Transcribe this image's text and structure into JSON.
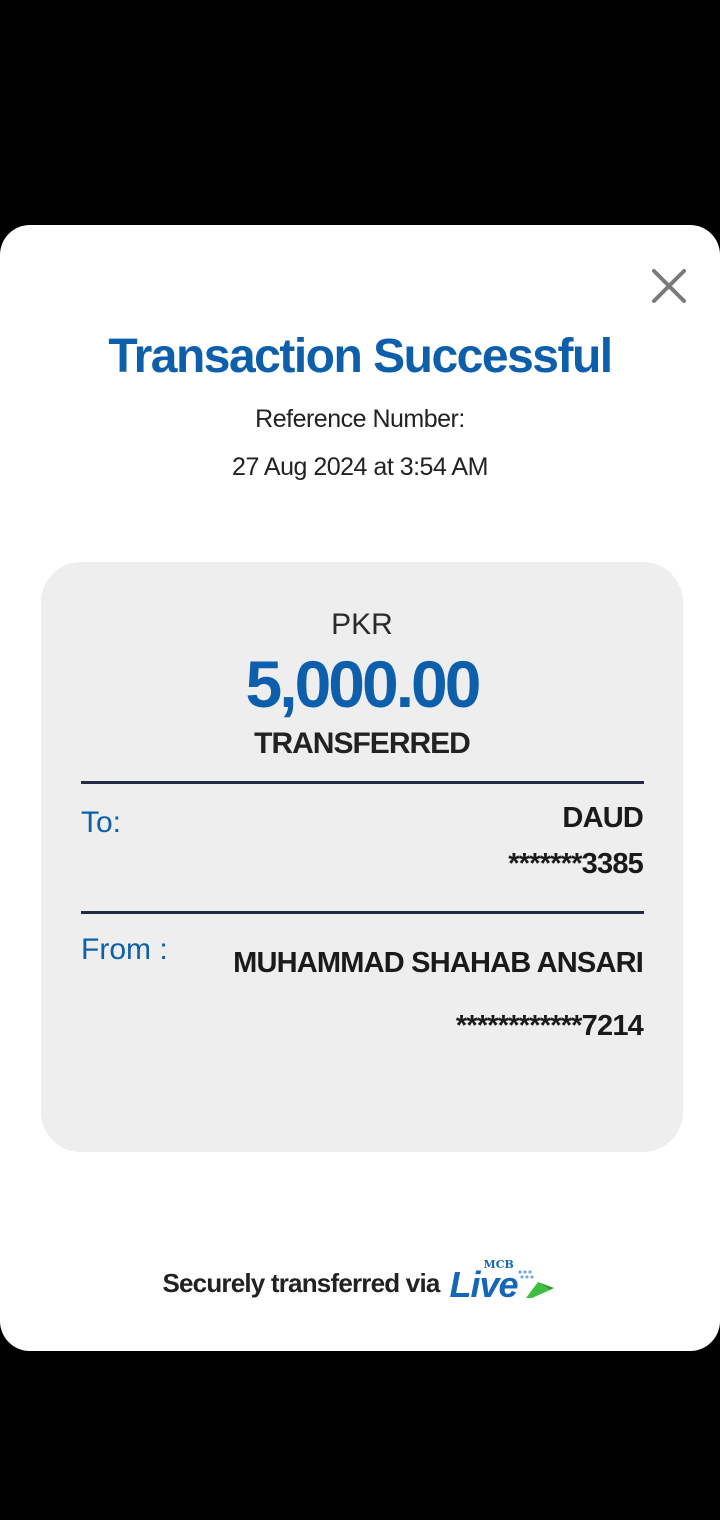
{
  "modal": {
    "title": "Transaction Successful",
    "reference_label": "Reference Number:",
    "datetime": "27 Aug 2024 at 3:54 AM"
  },
  "receipt": {
    "currency": "PKR",
    "amount": "5,000.00",
    "status": "TRANSFERRED",
    "to_label": "To:",
    "to_name": "DAUD",
    "to_account": "*******3385",
    "from_label": "From :",
    "from_name": "MUHAMMAD SHAHAB ANSARI",
    "from_account": "************7214"
  },
  "footer": {
    "text": "Securely transferred via",
    "brand": "Live",
    "brand_prefix": "MCB"
  },
  "icons": {
    "close": "close-icon",
    "brand_arrow": "arrow-icon"
  },
  "colors": {
    "accent": "#0d5fab",
    "background": "#000000",
    "card": "#eeeeef",
    "brand_green": "#3fbf3f"
  }
}
